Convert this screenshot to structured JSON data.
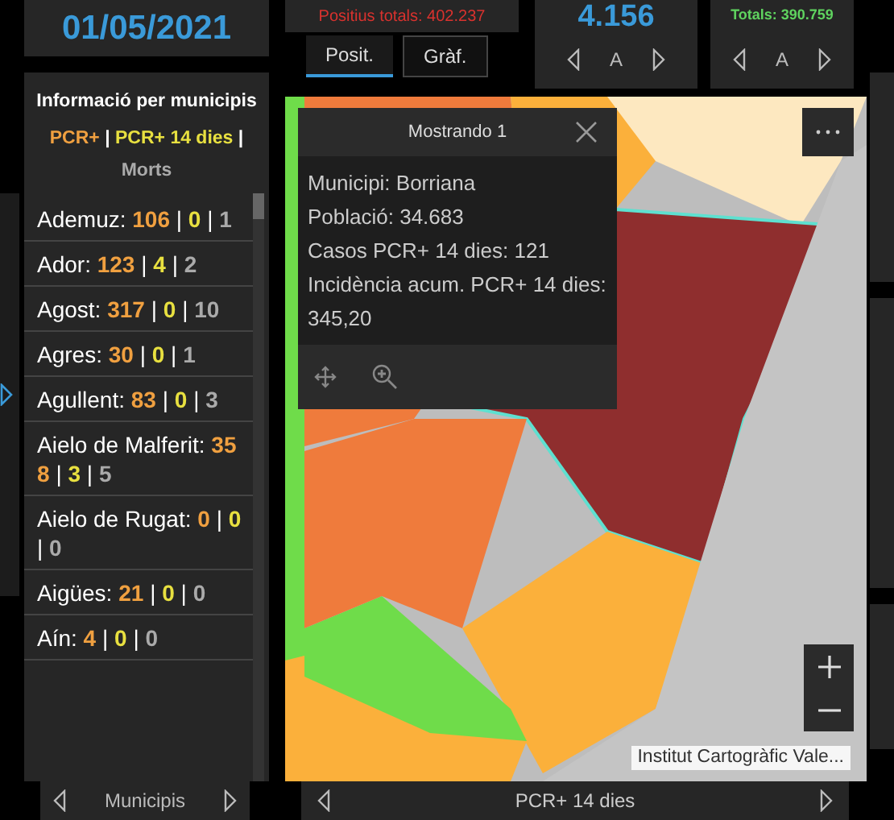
{
  "date": "01/05/2021",
  "positius_totals": "Positius totals: 402.237",
  "tabs": [
    {
      "label": "Posit.",
      "selected": true
    },
    {
      "label": "Gràf.",
      "selected": false
    }
  ],
  "counter_a": {
    "value": "4.156",
    "nav_label": "A"
  },
  "counter_b": {
    "value": "Totals: 390.759",
    "nav_label": "A"
  },
  "municipis_panel": {
    "title": "Informació per municipis",
    "legend": [
      "PCR+",
      "|",
      "PCR+ 14 dies",
      "|",
      "Morts"
    ],
    "rows": [
      {
        "parts": [
          "Ademuz:",
          "106",
          "|",
          "0",
          "|",
          "1"
        ]
      },
      {
        "parts": [
          "Ador:",
          "123",
          "|",
          "4",
          "|",
          "2"
        ]
      },
      {
        "parts": [
          "Agost:",
          "317",
          "|",
          "0",
          "|",
          "10"
        ]
      },
      {
        "parts": [
          "Agres:",
          "30",
          "|",
          "0",
          "|",
          "1"
        ]
      },
      {
        "parts": [
          "Agullent:",
          "83",
          "|",
          "0",
          "|",
          "3"
        ]
      },
      {
        "parts": [
          "Aielo de Malferit:",
          "358",
          "|",
          "3",
          "|",
          "5"
        ]
      },
      {
        "parts": [
          "Aielo de Rugat:",
          "0",
          "|",
          "0",
          "|",
          "0"
        ]
      },
      {
        "parts": [
          "Aigües:",
          "21",
          "|",
          "0",
          "|",
          "0"
        ]
      },
      {
        "parts": [
          "Aín:",
          "4",
          "|",
          "0",
          "|",
          "0"
        ]
      }
    ],
    "nav_label": "Municipis"
  },
  "popup": {
    "title": "Mostrando 1",
    "lines": [
      "Municipi: Borriana",
      "Població: 34.683",
      "Casos PCR+ 14 dies: 121",
      "Incidència acum. PCR+ 14 dies: 345,20"
    ]
  },
  "map": {
    "kind": "picture",
    "attribution": "Institut Cartogràfic Vale..."
  },
  "layer_nav": {
    "label": "PCR+ 14 dies"
  }
}
